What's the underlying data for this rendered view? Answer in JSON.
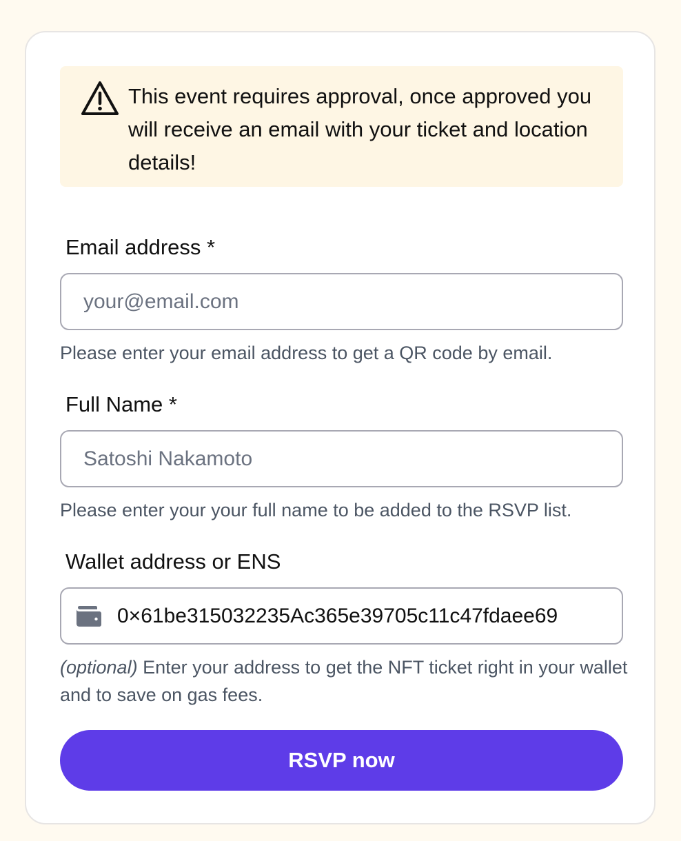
{
  "alert": {
    "icon": "warning-triangle-icon",
    "message": "This event requires approval, once approved you will receive an email with your ticket and location details!"
  },
  "form": {
    "email": {
      "label": "Email address *",
      "placeholder": "your@email.com",
      "value": "",
      "help": "Please enter your email address to get a QR code by email."
    },
    "name": {
      "label": "Full Name *",
      "placeholder": "Satoshi Nakamoto",
      "value": "",
      "help": "Please enter your your full name to be added to the RSVP list."
    },
    "wallet": {
      "label": "Wallet address or ENS",
      "icon": "wallet-icon",
      "value": "0×61be315032235Ac365e39705c11c47fdaee69",
      "help_prefix": "(optional)",
      "help": " Enter your address to get the NFT ticket right in your wallet and to save on gas fees."
    },
    "submit_label": "RSVP now"
  },
  "colors": {
    "page_background": "#fffaf0",
    "alert_background": "#fef6e4",
    "accent": "#5e3ce8",
    "help_text": "#4b5563"
  }
}
